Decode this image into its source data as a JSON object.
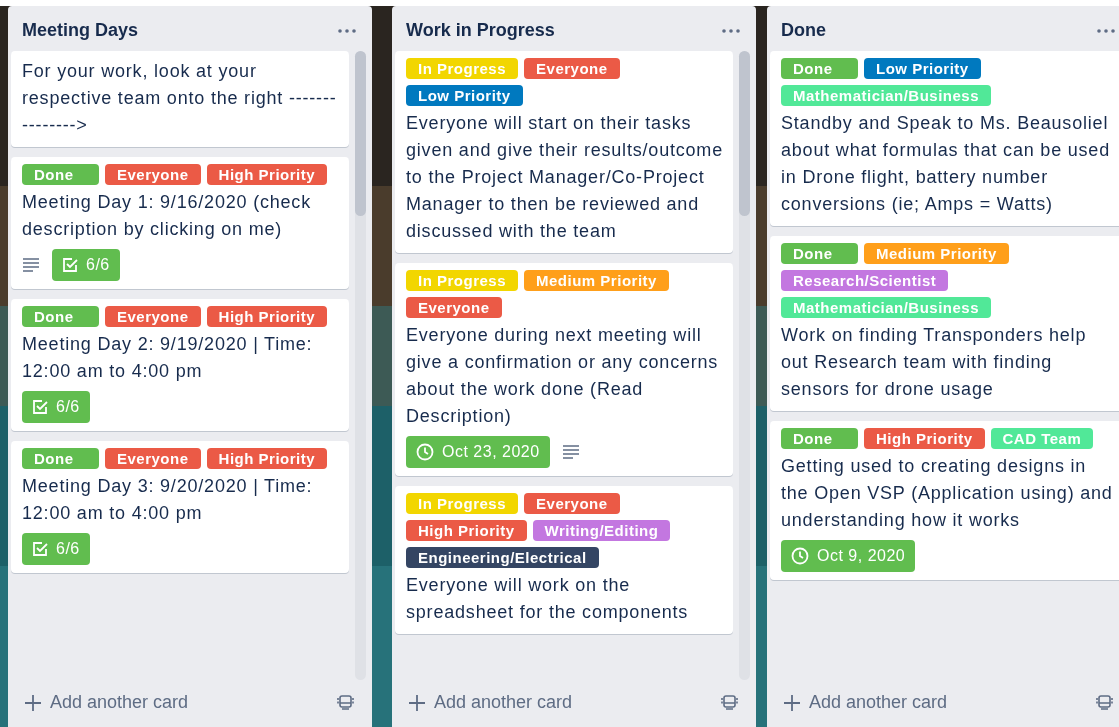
{
  "lists": [
    {
      "title": "Meeting Days",
      "scrollbar": true,
      "cards": [
        {
          "title": "For your work, look at your respective team onto the right --------------->"
        },
        {
          "labels": [
            {
              "text": "Done",
              "color": "#61bd4f"
            },
            {
              "text": "Everyone",
              "color": "#eb5a46"
            },
            {
              "text": "High Priority",
              "color": "#eb5a46"
            }
          ],
          "title": "Meeting Day 1: 9/16/2020 (check description by clicking on me)",
          "badges": [
            {
              "kind": "description"
            },
            {
              "kind": "checklist",
              "text": "6/6",
              "complete": true
            }
          ]
        },
        {
          "labels": [
            {
              "text": "Done",
              "color": "#61bd4f"
            },
            {
              "text": "Everyone",
              "color": "#eb5a46"
            },
            {
              "text": "High Priority",
              "color": "#eb5a46"
            }
          ],
          "title": "Meeting Day 2: 9/19/2020 | Time: 12:00 am to 4:00 pm",
          "badges": [
            {
              "kind": "checklist",
              "text": "6/6",
              "complete": true
            }
          ]
        },
        {
          "labels": [
            {
              "text": "Done",
              "color": "#61bd4f"
            },
            {
              "text": "Everyone",
              "color": "#eb5a46"
            },
            {
              "text": "High Priority",
              "color": "#eb5a46"
            }
          ],
          "title": "Meeting Day 3: 9/20/2020 | Time: 12:00 am to 4:00 pm",
          "badges": [
            {
              "kind": "checklist",
              "text": "6/6",
              "complete": true
            }
          ]
        }
      ],
      "add_label": "Add another card"
    },
    {
      "title": "Work in Progress",
      "scrollbar": true,
      "cards": [
        {
          "labels": [
            {
              "text": "In Progress",
              "color": "#f2d600"
            },
            {
              "text": "Everyone",
              "color": "#eb5a46"
            },
            {
              "text": "Low Priority",
              "color": "#0079bf"
            }
          ],
          "title": "Everyone will start on their tasks given and give their results/outcome to the Project Manager/Co-Project Manager to then be reviewed and discussed with the team"
        },
        {
          "labels": [
            {
              "text": "In Progress",
              "color": "#f2d600"
            },
            {
              "text": "Medium Priority",
              "color": "#ff9f1a"
            },
            {
              "text": "Everyone",
              "color": "#eb5a46"
            }
          ],
          "title": "Everyone during next meeting will give a confirmation or any concerns about the work done (Read Description)",
          "badges": [
            {
              "kind": "due",
              "text": "Oct 23, 2020",
              "complete": true
            },
            {
              "kind": "description"
            }
          ]
        },
        {
          "labels": [
            {
              "text": "In Progress",
              "color": "#f2d600"
            },
            {
              "text": "Everyone",
              "color": "#eb5a46"
            },
            {
              "text": "High Priority",
              "color": "#eb5a46"
            },
            {
              "text": "Writing/Editing",
              "color": "#c377e0"
            },
            {
              "text": "Engineering/Electrical",
              "color": "#344563"
            }
          ],
          "title": "Everyone will work on the spreadsheet for the components"
        }
      ],
      "add_label": "Add another card"
    },
    {
      "title": "Done",
      "scrollbar": false,
      "cards": [
        {
          "labels": [
            {
              "text": "Done",
              "color": "#61bd4f"
            },
            {
              "text": "Low Priority",
              "color": "#0079bf"
            },
            {
              "text": "Mathematician/Business",
              "color": "#51e898"
            }
          ],
          "title": "Standby and Speak to Ms. Beausoliel about what formulas that can be used in Drone flight, battery number conversions (ie; Amps = Watts)"
        },
        {
          "labels": [
            {
              "text": "Done",
              "color": "#61bd4f"
            },
            {
              "text": "Medium Priority",
              "color": "#ff9f1a"
            },
            {
              "text": "Research/Scientist",
              "color": "#c377e0"
            },
            {
              "text": "Mathematician/Business",
              "color": "#51e898"
            }
          ],
          "title": "Work on finding Transponders help out Research team with finding sensors for drone usage"
        },
        {
          "labels": [
            {
              "text": "Done",
              "color": "#61bd4f"
            },
            {
              "text": "High Priority",
              "color": "#eb5a46"
            },
            {
              "text": "CAD Team",
              "color": "#51e898"
            }
          ],
          "title": "Getting used to creating designs in the Open VSP (Application using) and understanding how it works",
          "badges": [
            {
              "kind": "due",
              "text": "Oct 9, 2020",
              "complete": true
            }
          ]
        }
      ],
      "add_label": "Add another card"
    }
  ]
}
